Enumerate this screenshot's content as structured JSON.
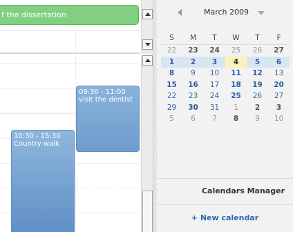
{
  "scheduler": {
    "allday_event": {
      "title": "f the dissertation",
      "color": "#82cf82"
    },
    "events": [
      {
        "time": "09:30 - 11:00",
        "title": "visit the dentist",
        "color": "#7ba7d6"
      },
      {
        "time": "10:30 - 15:30",
        "title": "Country walk",
        "color": "#7ba7d6"
      }
    ]
  },
  "minical": {
    "month": "March 2009",
    "weekdays": [
      "S",
      "M",
      "T",
      "W",
      "T",
      "F"
    ],
    "weeks": [
      [
        "22",
        "23",
        "24",
        "25",
        "26",
        "27"
      ],
      [
        "1",
        "2",
        "3",
        "4",
        "5",
        "6"
      ],
      [
        "8",
        "9",
        "10",
        "11",
        "12",
        "13"
      ],
      [
        "15",
        "16",
        "17",
        "18",
        "19",
        "20"
      ],
      [
        "22",
        "23",
        "24",
        "25",
        "26",
        "27"
      ],
      [
        "29",
        "30",
        "31",
        "1",
        "2",
        "3"
      ],
      [
        "5",
        "6",
        "7",
        "8",
        "9",
        "10"
      ]
    ],
    "today": "4",
    "accent": "#2a5aa8"
  },
  "calendars_manager": {
    "title": "Calendars Manager",
    "new_calendar": "+ New calendar"
  }
}
